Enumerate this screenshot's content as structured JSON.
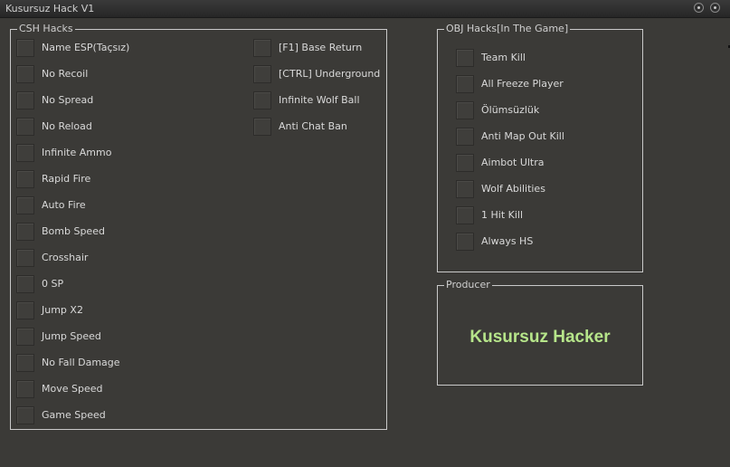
{
  "window": {
    "title": "Kusursuz Hack V1"
  },
  "csh": {
    "legend": "CSH Hacks",
    "col1": [
      "Name ESP(Taçsız)",
      "No Recoil",
      "No Spread",
      "No Reload",
      "Infinite Ammo",
      "Rapid Fire",
      "Auto Fire",
      "Bomb Speed",
      "Crosshair",
      "0 SP",
      "Jump X2",
      "Jump Speed",
      "No Fall Damage",
      "Move Speed",
      "Game Speed"
    ],
    "col2": [
      "[F1] Base Return",
      "[CTRL] Underground",
      "Infinite Wolf Ball",
      "Anti Chat Ban"
    ]
  },
  "obj": {
    "legend": "OBJ Hacks[In The Game]",
    "items": [
      "Team Kill",
      "All Freeze Player",
      "Ölümsüzlük",
      "Anti Map Out Kill",
      "Aimbot Ultra",
      "Wolf Abilities",
      "1 Hit Kill",
      "Always HS"
    ]
  },
  "producer": {
    "legend": "Producer",
    "name": "Kusursuz Hacker",
    "name_color": "#b6e58a"
  }
}
